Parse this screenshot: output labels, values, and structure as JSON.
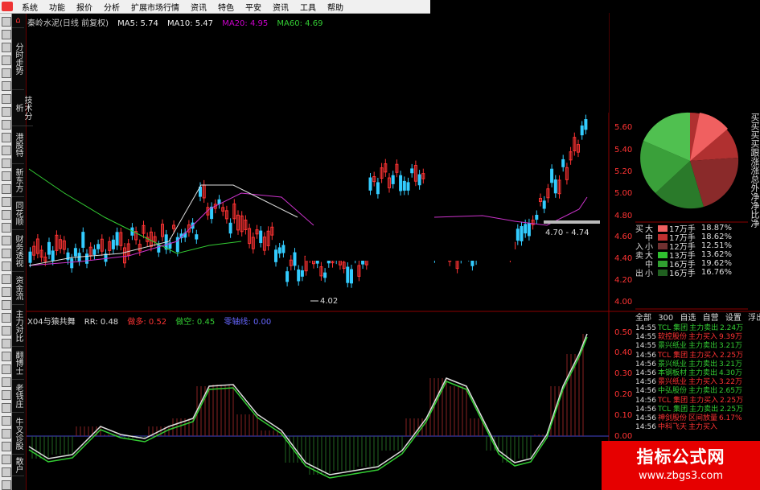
{
  "menu": [
    "系统",
    "功能",
    "报价",
    "分析",
    "扩展市场行情",
    "资讯",
    "特色",
    "平安",
    "资讯",
    "工具",
    "帮助"
  ],
  "left_tabs": [
    "分时走势",
    "技术分析",
    "港股特",
    "新东方",
    "同花顺",
    "财务透视",
    "资金流",
    "主力对比",
    "翻博士",
    "老钱庄",
    "牛叉诊股",
    "散户"
  ],
  "stock": {
    "name": "秦岭水泥(日线 前复权)",
    "ma5": "MA5: 5.74",
    "ma10": "MA10: 5.47",
    "ma20": "MA20: 4.95",
    "ma60": "MA60: 4.69"
  },
  "price_axis": [
    "5.60",
    "5.40",
    "5.20",
    "5.00",
    "4.80",
    "4.60",
    "4.40",
    "4.20",
    "4.00"
  ],
  "price_labels": {
    "low": "4.02",
    "band": "4.70 - 4.74"
  },
  "indicator": {
    "name": "X04与猿共舞",
    "rr": "RR: 0.48",
    "up": "做多: 0.52",
    "down": "做空: 0.45",
    "zero": "零轴线: 0.00"
  },
  "indicator_axis": [
    "0.50",
    "0.40",
    "0.30",
    "0.20",
    "0.10",
    "0.00"
  ],
  "volume_table": [
    {
      "side": "买",
      "size": "大",
      "amt": "17万手",
      "pct": "18.87%",
      "color": "#f06060"
    },
    {
      "side": "",
      "size": "中",
      "amt": "17万手",
      "pct": "18.62%",
      "color": "#c03030"
    },
    {
      "side": "入",
      "size": "小",
      "amt": "12万手",
      "pct": "12.51%",
      "color": "#703030"
    },
    {
      "side": "卖",
      "size": "大",
      "amt": "13万手",
      "pct": "13.62%",
      "color": "#30c030"
    },
    {
      "side": "",
      "size": "中",
      "amt": "16万手",
      "pct": "19.62%",
      "color": "#30a030"
    },
    {
      "side": "出",
      "size": "小",
      "amt": "16万手",
      "pct": "16.76%",
      "color": "#206020"
    }
  ],
  "list_tabs": [
    "全部",
    "300",
    "自选",
    "自营",
    "设置",
    "浮出",
    "扌"
  ],
  "trades": [
    {
      "t": "14:55",
      "nm": "TCL 集团",
      "act": "主力卖出",
      "val": "2.24万"
    },
    {
      "t": "14:55",
      "nm": "软控股份",
      "act": "主力买入",
      "val": "9.39万"
    },
    {
      "t": "14:55",
      "nm": "景兴纸业",
      "act": "主力卖出",
      "val": "3.21万"
    },
    {
      "t": "14:56",
      "nm": "TCL 集团",
      "act": "主力买入",
      "val": "2.25万"
    },
    {
      "t": "14:56",
      "nm": "景兴纸业",
      "act": "主力卖出",
      "val": "3.21万"
    },
    {
      "t": "14:56",
      "nm": "本钢板材",
      "act": "主力卖出",
      "val": "4.30万"
    },
    {
      "t": "14:56",
      "nm": "景兴纸业",
      "act": "主力买入",
      "val": "3.22万"
    },
    {
      "t": "14:56",
      "nm": "中弘股份",
      "act": "主力卖出",
      "val": "2.65万"
    },
    {
      "t": "14:56",
      "nm": "TCL 集团",
      "act": "主力买入",
      "val": "2.25万"
    },
    {
      "t": "14:56",
      "nm": "TCL 集团",
      "act": "主力卖出",
      "val": "2.25万"
    },
    {
      "t": "14:56",
      "nm": "神剑股份",
      "act": "区间放量",
      "val": "6.17%"
    },
    {
      "t": "14:56",
      "nm": "中科飞天",
      "act": "主力买入",
      "val": ""
    }
  ],
  "side_chars": "买买买买跟涨涨总外净净比净",
  "watermark": {
    "line1": "指标公式网",
    "line2": "www.zbgs3.com"
  },
  "colors": {
    "up": "#ff3333",
    "down": "#33ccff",
    "ma20": "#cc33cc",
    "ma60": "#33cc33",
    "grid": "#8b0000"
  }
}
